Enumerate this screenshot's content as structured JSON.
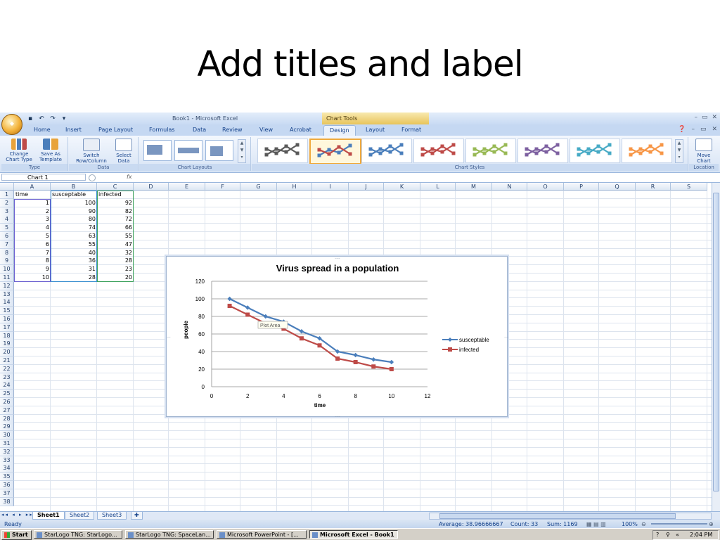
{
  "slide": {
    "title": "Add titles and label"
  },
  "window": {
    "title": "Book1 - Microsoft Excel",
    "context_tab_group": "Chart Tools",
    "controls": [
      "–",
      "▭",
      "✕"
    ]
  },
  "ribbon_tabs": [
    "Home",
    "Insert",
    "Page Layout",
    "Formulas",
    "Data",
    "Review",
    "View",
    "Acrobat",
    "Design",
    "Layout",
    "Format"
  ],
  "active_tab": "Design",
  "ribbon": {
    "groups": {
      "type": "Type",
      "data": "Data",
      "chart_layouts": "Chart Layouts",
      "chart_styles": "Chart Styles",
      "location": "Location"
    },
    "buttons": {
      "change_chart_type_1": "Change",
      "change_chart_type_2": "Chart Type",
      "save_as_template_1": "Save As",
      "save_as_template_2": "Template",
      "switch_row_column_1": "Switch",
      "switch_row_column_2": "Row/Column",
      "select_data_1": "Select",
      "select_data_2": "Data",
      "move_chart_1": "Move",
      "move_chart_2": "Chart"
    },
    "chart_style_colors": [
      "#595959",
      "#4a7ebb",
      "#4a7ebb",
      "#be4b48",
      "#98b954",
      "#7d60a0",
      "#46aac5",
      "#f79646"
    ]
  },
  "formula_bar": {
    "name_box": "Chart 1",
    "fx_label": "fx",
    "value": ""
  },
  "sheet": {
    "columns": [
      "A",
      "B",
      "C",
      "D",
      "E",
      "F",
      "G",
      "H",
      "I",
      "J",
      "K",
      "L",
      "M",
      "N",
      "O",
      "P",
      "Q",
      "R",
      "S"
    ],
    "row_numbers": [
      "1",
      "2",
      "3",
      "4",
      "5",
      "6",
      "7",
      "8",
      "9",
      "10",
      "11",
      "12",
      "13",
      "14",
      "15",
      "16",
      "17",
      "18",
      "19",
      "20",
      "21",
      "22",
      "23",
      "24",
      "25",
      "26",
      "27",
      "28",
      "29",
      "30",
      "31",
      "32",
      "33",
      "34",
      "35",
      "36",
      "37",
      "38"
    ],
    "headers": [
      "time",
      "susceptable",
      "infected"
    ],
    "rows": [
      [
        "1",
        "100",
        "92"
      ],
      [
        "2",
        "90",
        "82"
      ],
      [
        "3",
        "80",
        "72"
      ],
      [
        "4",
        "74",
        "66"
      ],
      [
        "5",
        "63",
        "55"
      ],
      [
        "6",
        "55",
        "47"
      ],
      [
        "7",
        "40",
        "32"
      ],
      [
        "8",
        "36",
        "28"
      ],
      [
        "9",
        "31",
        "23"
      ],
      [
        "10",
        "28",
        "20"
      ]
    ]
  },
  "chart_data": {
    "type": "scatter",
    "title": "Virus spread in a population",
    "xlabel": "time",
    "ylabel": "people",
    "xlim": [
      0,
      12
    ],
    "ylim": [
      0,
      120
    ],
    "xticks": [
      "0",
      "2",
      "4",
      "6",
      "8",
      "10",
      "12"
    ],
    "yticks": [
      "0",
      "20",
      "40",
      "60",
      "80",
      "100",
      "120"
    ],
    "grid": "horizontal",
    "legend_position": "right",
    "tooltip": "Plot Area",
    "x": [
      1,
      2,
      3,
      4,
      5,
      6,
      7,
      8,
      9,
      10
    ],
    "series": [
      {
        "name": "susceptable",
        "color": "#4a7ebb",
        "marker": "diamond",
        "values": [
          100,
          90,
          80,
          74,
          63,
          55,
          40,
          36,
          31,
          28
        ]
      },
      {
        "name": "infected",
        "color": "#be4b48",
        "marker": "square",
        "values": [
          92,
          82,
          72,
          66,
          55,
          47,
          32,
          28,
          23,
          20
        ]
      }
    ]
  },
  "sheet_tabs": [
    "Sheet1",
    "Sheet2",
    "Sheet3"
  ],
  "active_sheet": "Sheet1",
  "status": {
    "mode": "Ready",
    "average": "Average: 38.96666667",
    "count": "Count: 33",
    "sum": "Sum: 1169",
    "zoom": "100%"
  },
  "taskbar": {
    "start": "Start",
    "tasks": [
      "StarLogo TNG: StarLogo...",
      "StarLogo TNG: SpaceLan...",
      "Microsoft PowerPoint - [...",
      "Microsoft Excel - Book1"
    ],
    "active_task": "Microsoft Excel - Book1",
    "clock": "2:04 PM"
  }
}
